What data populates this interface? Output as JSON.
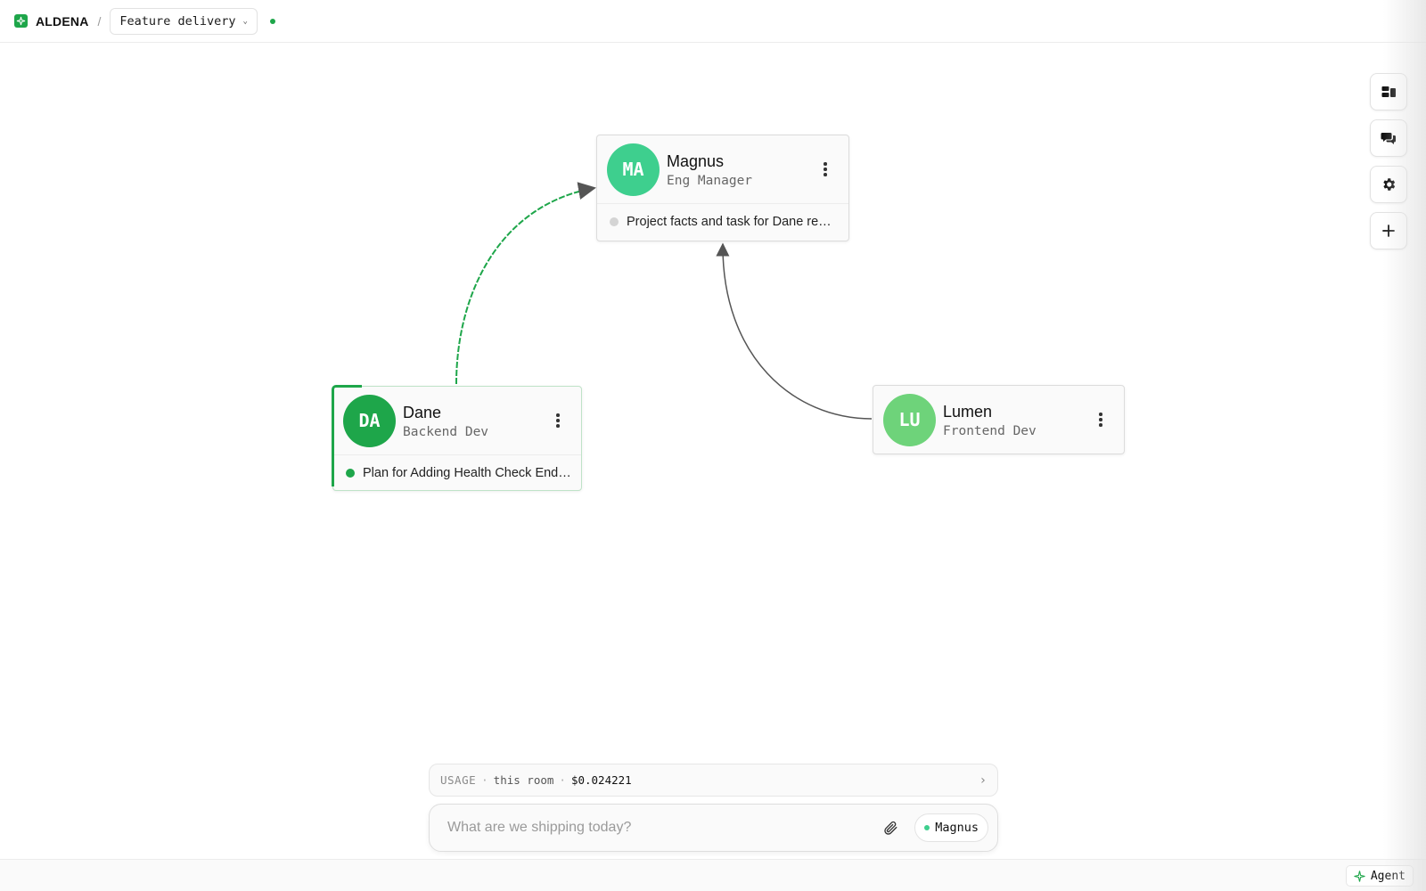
{
  "header": {
    "brand": "ALDENA",
    "separator": "/",
    "room_name": "Feature delivery"
  },
  "colors": {
    "accent": "#1ea64a",
    "manager_avatar": "#3ecf8e",
    "backend_avatar": "#1ea64a",
    "frontend_avatar": "#6ed37a"
  },
  "rail": {
    "buttons": [
      {
        "icon": "layout-icon"
      },
      {
        "icon": "chat-icon"
      },
      {
        "icon": "gear-icon"
      },
      {
        "icon": "plus-icon"
      }
    ]
  },
  "nodes": {
    "magnus": {
      "initials": "MA",
      "name": "Magnus",
      "role": "Eng Manager",
      "task": "Project facts and task for Dane re…",
      "task_status": "idle"
    },
    "dane": {
      "initials": "DA",
      "name": "Dane",
      "role": "Backend Dev",
      "task": "Plan for Adding Health Check End…",
      "task_status": "active"
    },
    "lumen": {
      "initials": "LU",
      "name": "Lumen",
      "role": "Frontend Dev"
    }
  },
  "usage": {
    "label": "USAGE",
    "sep": "·",
    "scope": "this room",
    "cost": "$0.024221"
  },
  "composer": {
    "placeholder": "What are we shipping today?",
    "target": "Magnus"
  },
  "footer": {
    "agent_label": "Agent"
  }
}
